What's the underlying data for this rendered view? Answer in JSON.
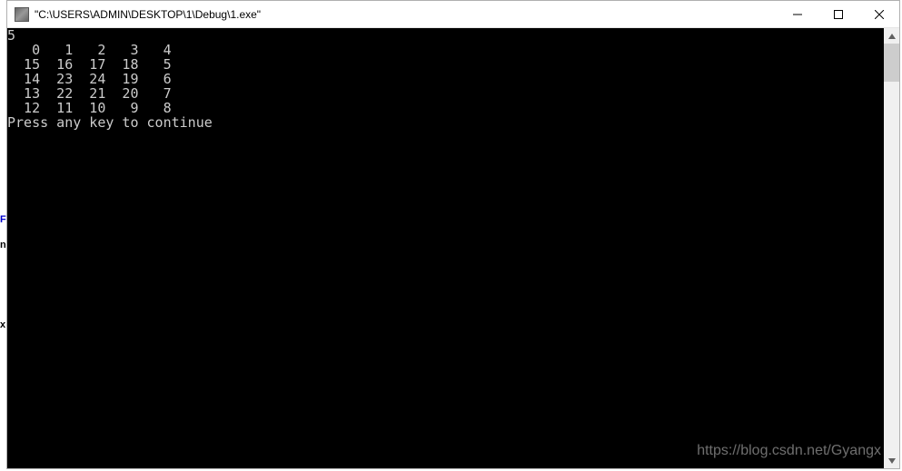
{
  "left_edge": {
    "f": "F",
    "n": "n",
    "x": "x"
  },
  "window": {
    "title": "\"C:\\USERS\\ADMIN\\DESKTOP\\1\\Debug\\1.exe\""
  },
  "console": {
    "input": "5",
    "matrix": [
      [
        "0",
        "1",
        "2",
        "3",
        "4"
      ],
      [
        "15",
        "16",
        "17",
        "18",
        "5"
      ],
      [
        "14",
        "23",
        "24",
        "19",
        "6"
      ],
      [
        "13",
        "22",
        "21",
        "20",
        "7"
      ],
      [
        "12",
        "11",
        "10",
        "9",
        "8"
      ]
    ],
    "prompt": "Press any key to continue"
  },
  "watermark": "https://blog.csdn.net/Gyangx"
}
